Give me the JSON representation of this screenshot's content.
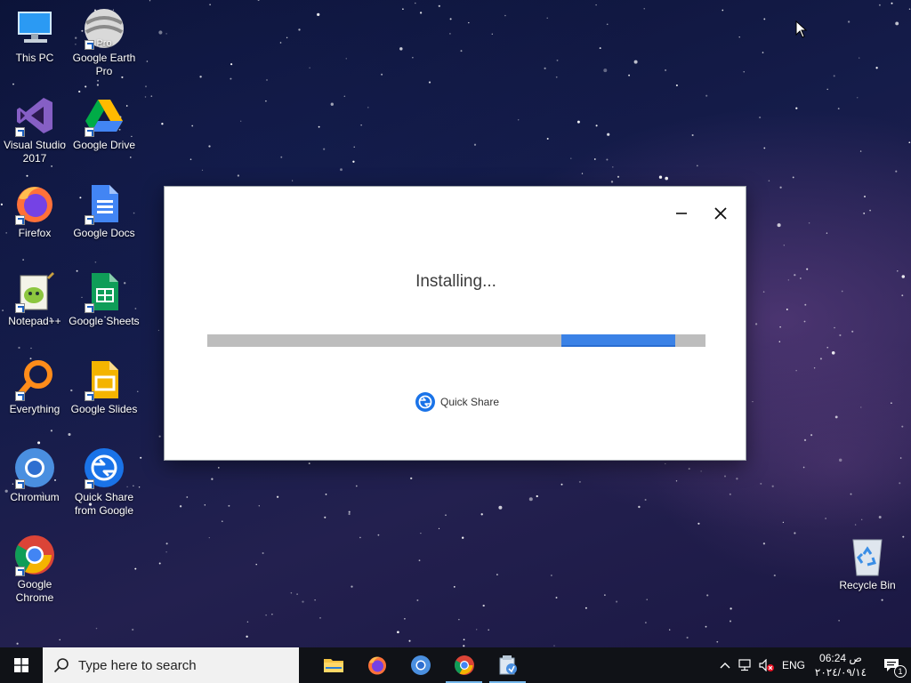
{
  "desktop": {
    "icons": [
      {
        "label": "This PC",
        "icon": "computer-icon"
      },
      {
        "label": "Google Earth Pro",
        "icon": "google-earth-icon",
        "badge": "Pro"
      },
      {
        "label": "Visual Studio 2017",
        "icon": "visual-studio-icon"
      },
      {
        "label": "Google Drive",
        "icon": "google-drive-icon"
      },
      {
        "label": "Firefox",
        "icon": "firefox-icon"
      },
      {
        "label": "Google Docs",
        "icon": "google-docs-icon"
      },
      {
        "label": "Notepad++",
        "icon": "notepad-plus-plus-icon"
      },
      {
        "label": "Google Sheets",
        "icon": "google-sheets-icon"
      },
      {
        "label": "Everything",
        "icon": "everything-search-icon"
      },
      {
        "label": "Google Slides",
        "icon": "google-slides-icon"
      },
      {
        "label": "Chromium",
        "icon": "chromium-icon"
      },
      {
        "label": "Quick Share from Google",
        "icon": "quick-share-icon"
      },
      {
        "label": "Google Chrome",
        "icon": "chrome-icon"
      },
      {
        "label": "Recycle Bin",
        "icon": "recycle-bin-icon"
      }
    ]
  },
  "dialog": {
    "title": "Installing...",
    "progress_start": 0.71,
    "progress_end": 0.94,
    "brand_label": "Quick Share",
    "minimize_icon": "minimize-icon",
    "close_icon": "close-icon"
  },
  "taskbar": {
    "search_placeholder": "Type here to search",
    "apps": [
      {
        "name": "File Explorer",
        "icon": "folder-icon",
        "running": false
      },
      {
        "name": "Firefox",
        "icon": "firefox-icon",
        "running": false
      },
      {
        "name": "Chromium",
        "icon": "chromium-icon",
        "running": false
      },
      {
        "name": "Google Chrome",
        "icon": "chrome-icon",
        "running": true
      },
      {
        "name": "Installer",
        "icon": "installer-icon",
        "running": true
      }
    ],
    "tray": {
      "language": "ENG",
      "time": "06:24 ص",
      "date": "٢٠٢٤/٠٩/١٤",
      "notification_count": "1"
    }
  },
  "colors": {
    "accent": "#3b82e6",
    "progress_track": "#bdbdbd",
    "taskbar": "#101217"
  }
}
